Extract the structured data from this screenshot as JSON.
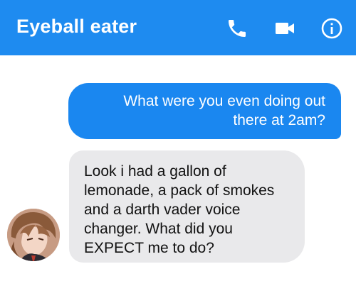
{
  "header": {
    "contact_name": "Eyeball eater",
    "icons": [
      "phone-icon",
      "video-camera-icon",
      "info-icon"
    ],
    "color": "#1e8bf0"
  },
  "messages": [
    {
      "direction": "outgoing",
      "text": "What were you even doing out there at 2am?"
    },
    {
      "direction": "incoming",
      "text": "Look i had a gallon of lemonade, a pack of smokes and a darth vader voice changer. What did you EXPECT me to do?"
    }
  ],
  "colors": {
    "outgoing_bubble": "#1a87f0",
    "incoming_bubble": "#e9e9eb"
  }
}
